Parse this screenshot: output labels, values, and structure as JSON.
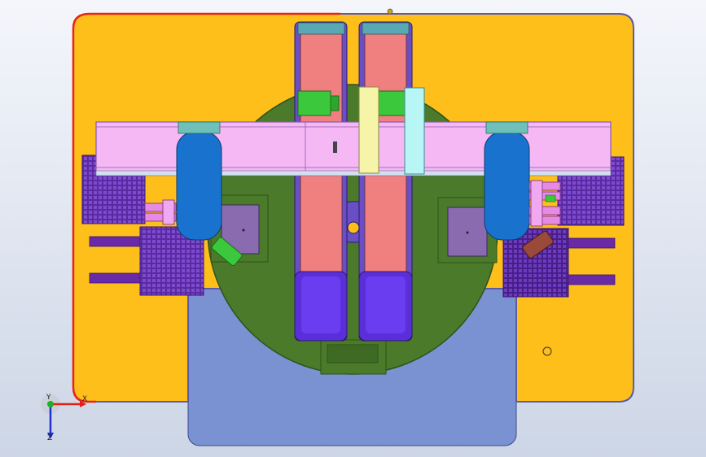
{
  "viewport": {
    "background_top": "#f4f6fb",
    "background_bottom": "#cdd6e6",
    "colors": {
      "base_plate": "#ffbf1a",
      "base_plate_edge": "#e8231a",
      "base_plate_edge_alt": "#5b5ba8",
      "lower_block": "#7a92d2",
      "turntable": "#4a7a2a",
      "turntable_edge": "#2f5119",
      "rail": "#f07f7f",
      "rail_frame": "#6a4ec6",
      "rail_end": "#5a2ed8",
      "rail_cap": "#5aa8b4",
      "crossbeam": "#f5b8f5",
      "crossbeam_edge": "#8c5aa8",
      "clamp_arm": "#1a72cf",
      "clamp_cap": "#6ec0b8",
      "grid_pad": "#5a2aa0",
      "slot_bar": "#6a2aa8",
      "pocket": "#8a6bb0",
      "green_part": "#3cc83c",
      "pink_fitting": "#e58ae5",
      "brown_part": "#9a4a3a",
      "yellow_block": "#f6f4a8",
      "cyan_block": "#b8f6f6"
    }
  },
  "triad": {
    "x_label": "X",
    "y_label": "Y",
    "z_label": "Z",
    "x_color": "#e0201a",
    "y_color": "#20b020",
    "z_color": "#2030d0"
  }
}
